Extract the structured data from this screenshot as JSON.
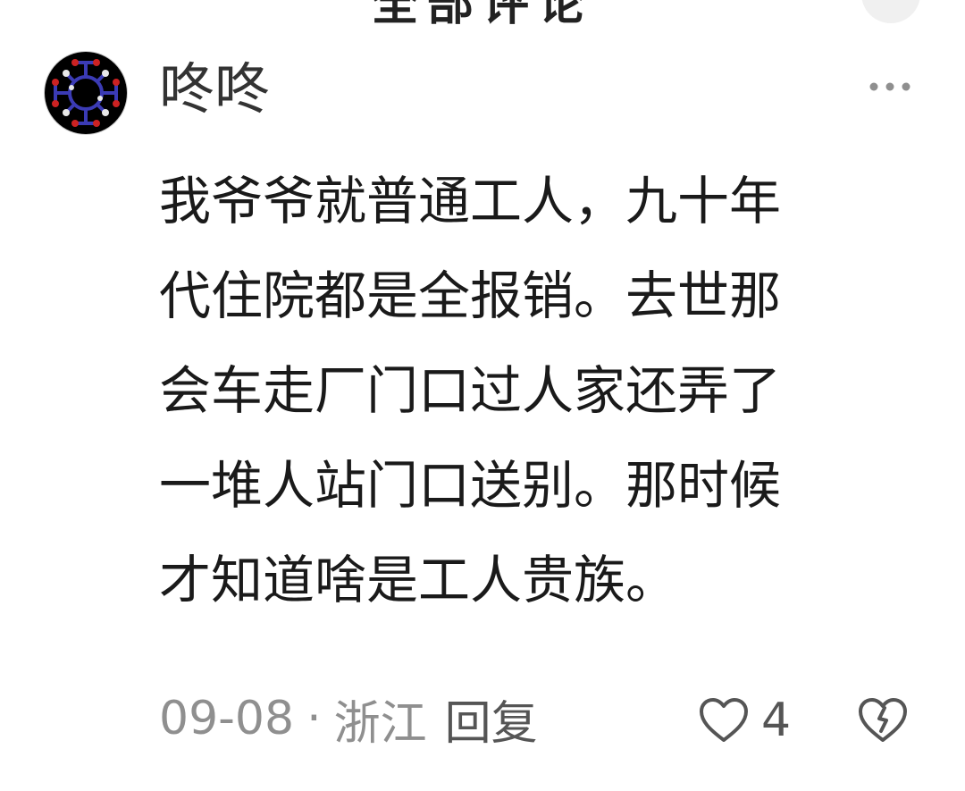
{
  "header": {
    "title": "全部评论",
    "close_icon": "close-icon"
  },
  "comment": {
    "avatar_icon": "molecule-avatar-icon",
    "username": "咚咚",
    "more_icon": "more-horizontal-icon",
    "lines": [
      "我爷爷就普通工人，九十年",
      "代住院都是全报销。去世那",
      "会车走厂门口过人家还弄了",
      "一堆人站门口送别。那时候",
      "才知道啥是工人贵族。"
    ],
    "date": "09-08",
    "separator": "·",
    "location": "浙江",
    "reply_label": "回复",
    "like_icon": "heart-outline-icon",
    "like_count": "4",
    "dislike_icon": "broken-heart-icon"
  },
  "colors": {
    "text": "#1a1a1a",
    "meta": "#8f8f8f",
    "icon": "#555555",
    "avatar_bg": "#000000",
    "avatar_bond": "#3333aa",
    "avatar_oxygen": "#cc2222",
    "avatar_hydrogen": "#e8e8e8"
  }
}
